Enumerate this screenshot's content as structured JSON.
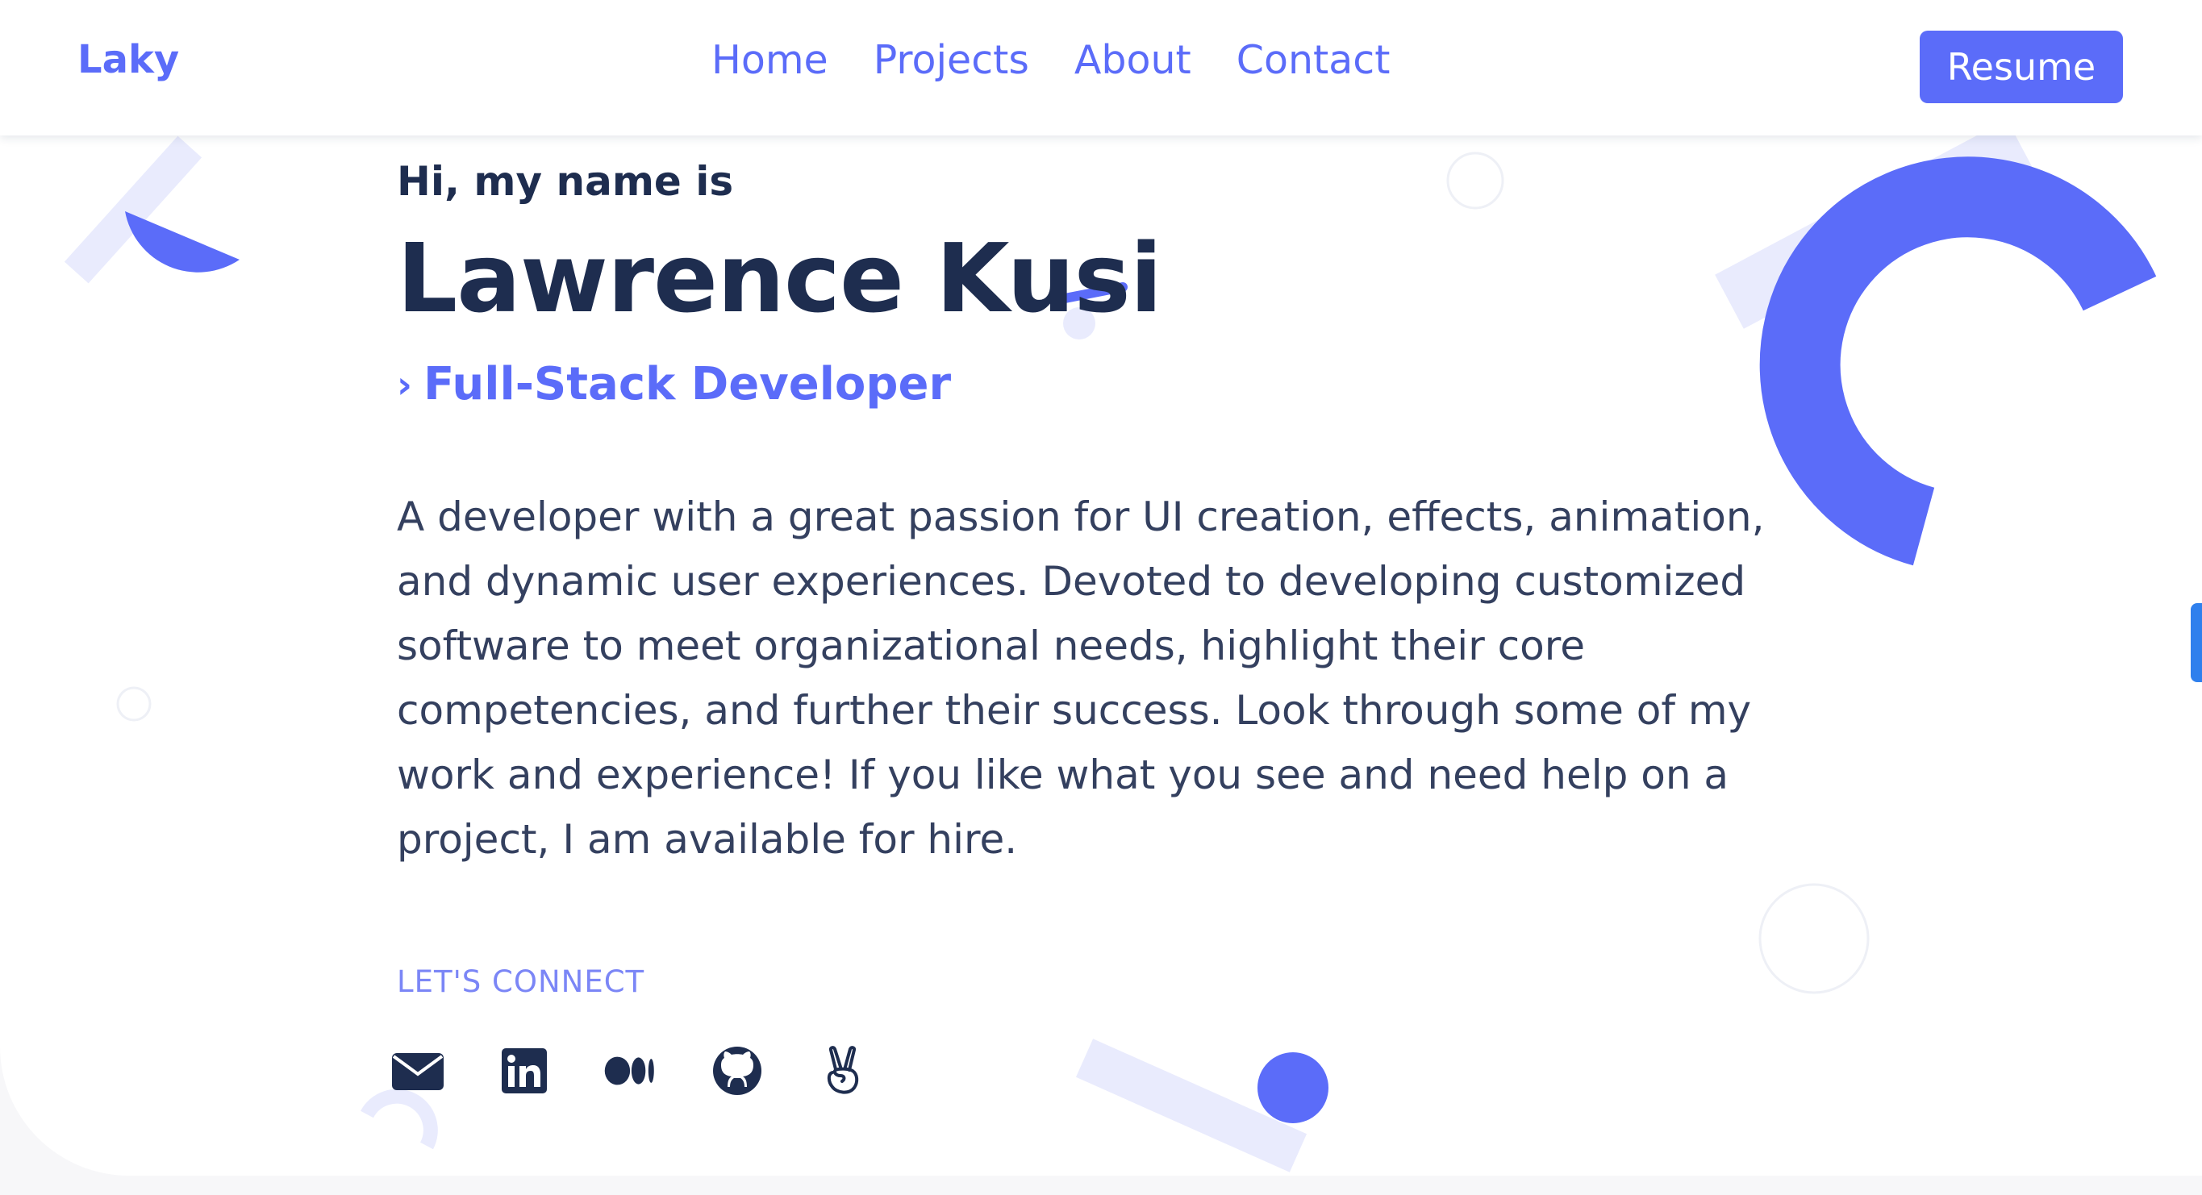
{
  "nav": {
    "logo": "Laky",
    "links": [
      "Home",
      "Projects",
      "About",
      "Contact"
    ],
    "resume_label": "Resume"
  },
  "hero": {
    "greeting": "Hi, my name is",
    "name": "Lawrence Kusi",
    "role_icon": "›",
    "role": "Full-Stack Developer",
    "bio": "A developer with a great passion for UI creation, effects, animation, and dynamic user experiences. Devoted to developing customized software to meet organizational needs, highlight their core competencies, and further their success. Look through some of my work and experience! If you like what you see and need help on a project, I am available for hire."
  },
  "connect": {
    "label": "LET'S CONNECT",
    "icons": [
      "mail-icon",
      "linkedin-icon",
      "medium-icon",
      "github-icon",
      "angellist-icon"
    ]
  },
  "colors": {
    "accent": "#5b6cf9",
    "accent_light": "#e9ebfd",
    "text_dark": "#1e2d4f",
    "body_text": "#34405f"
  }
}
